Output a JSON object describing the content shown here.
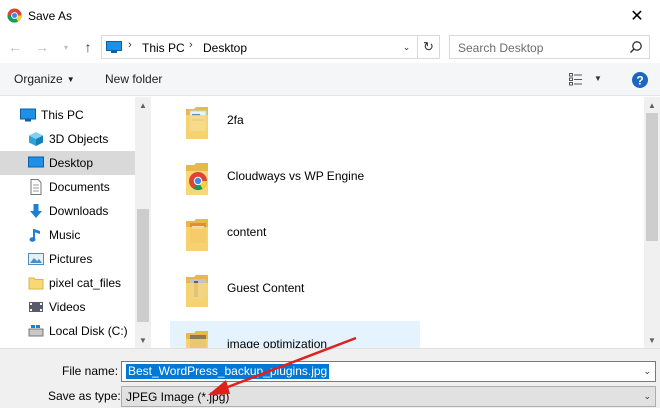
{
  "window": {
    "title": "Save As"
  },
  "address": {
    "crumbs": [
      "This PC",
      "Desktop"
    ]
  },
  "search": {
    "placeholder": "Search Desktop"
  },
  "toolbar": {
    "organize": "Organize",
    "new_folder": "New folder"
  },
  "sidebar": {
    "items": [
      {
        "label": "This PC",
        "icon": "pc-icon"
      },
      {
        "label": "3D Objects",
        "icon": "cube-icon"
      },
      {
        "label": "Desktop",
        "icon": "desktop-icon",
        "selected": true
      },
      {
        "label": "Documents",
        "icon": "documents-icon"
      },
      {
        "label": "Downloads",
        "icon": "download-icon"
      },
      {
        "label": "Music",
        "icon": "music-icon"
      },
      {
        "label": "Pictures",
        "icon": "pictures-icon"
      },
      {
        "label": "pixel cat_files",
        "icon": "folder-icon"
      },
      {
        "label": "Videos",
        "icon": "videos-icon"
      },
      {
        "label": "Local Disk (C:)",
        "icon": "disk-icon"
      }
    ]
  },
  "files": [
    {
      "name": "2fa",
      "icon": "folder-icon"
    },
    {
      "name": "Cloudways vs WP Engine",
      "icon": "chrome-folder-icon"
    },
    {
      "name": "content",
      "icon": "folder-icon"
    },
    {
      "name": "Guest Content",
      "icon": "folder-icon"
    },
    {
      "name": "image optimization",
      "icon": "folder-icon",
      "hover": true
    }
  ],
  "form": {
    "filename_label": "File name:",
    "filename_value": "Best_WordPress_backup_plugins.jpg",
    "type_label": "Save as type:",
    "type_value": "JPEG Image (*.jpg)"
  },
  "colors": {
    "accent": "#0078d7",
    "annotation": "#e0201a",
    "selected": "#d9d9d9"
  }
}
